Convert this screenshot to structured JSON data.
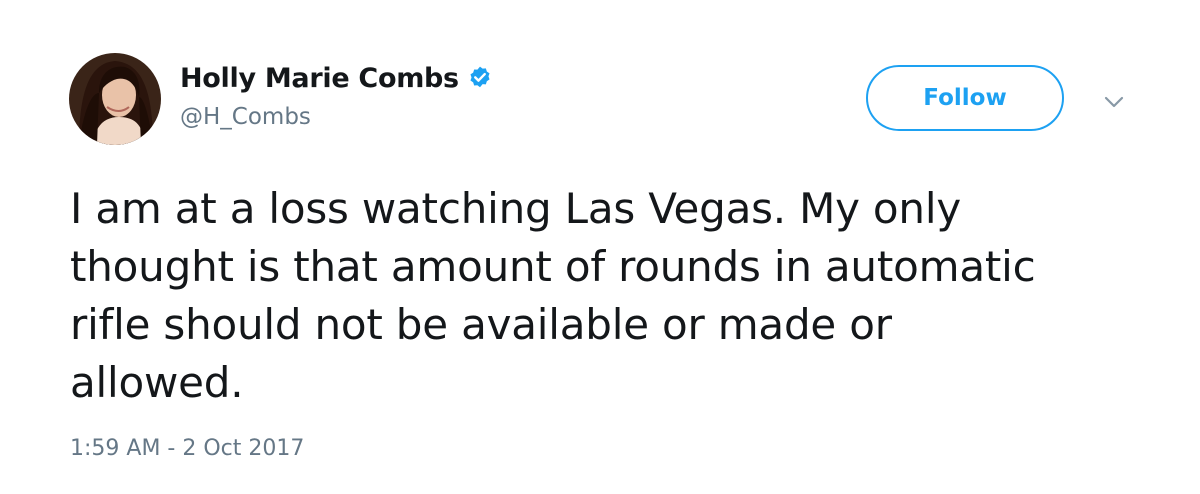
{
  "tweet": {
    "author": {
      "display_name": "Holly Marie Combs",
      "handle": "@H_Combs",
      "verified": true,
      "avatar_icon": "profile-photo"
    },
    "follow_label": "Follow",
    "menu_icon": "chevron-down-icon",
    "text": "I am at a loss watching Las Vegas. My only thought is that amount of rounds in automatic rifle should not be available or made or allowed.",
    "timestamp": "1:59 AM - 2 Oct 2017"
  },
  "colors": {
    "accent": "#1da1f2",
    "secondary_text": "#657786",
    "primary_text": "#14171a",
    "verified_badge": "#1da1f2"
  }
}
